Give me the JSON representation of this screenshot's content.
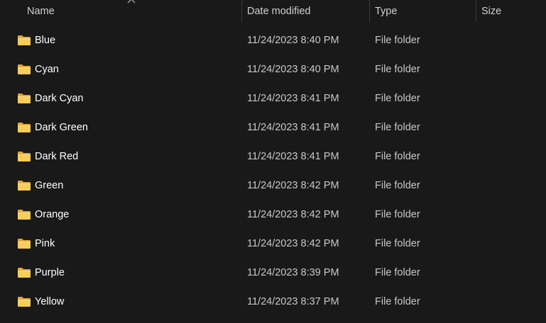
{
  "columns": {
    "name": "Name",
    "date_modified": "Date modified",
    "type": "Type",
    "size": "Size"
  },
  "icons": {
    "folder": "folder-icon",
    "sort": "sort-up-caret-icon"
  },
  "colors": {
    "background": "#191919",
    "folder_yellow": "#f4c64f"
  },
  "files": [
    {
      "name": "Blue",
      "date": "11/24/2023 8:40 PM",
      "type": "File folder",
      "size": ""
    },
    {
      "name": "Cyan",
      "date": "11/24/2023 8:40 PM",
      "type": "File folder",
      "size": ""
    },
    {
      "name": "Dark Cyan",
      "date": "11/24/2023 8:41 PM",
      "type": "File folder",
      "size": ""
    },
    {
      "name": "Dark Green",
      "date": "11/24/2023 8:41 PM",
      "type": "File folder",
      "size": ""
    },
    {
      "name": "Dark Red",
      "date": "11/24/2023 8:41 PM",
      "type": "File folder",
      "size": ""
    },
    {
      "name": "Green",
      "date": "11/24/2023 8:42 PM",
      "type": "File folder",
      "size": ""
    },
    {
      "name": "Orange",
      "date": "11/24/2023 8:42 PM",
      "type": "File folder",
      "size": ""
    },
    {
      "name": "Pink",
      "date": "11/24/2023 8:42 PM",
      "type": "File folder",
      "size": ""
    },
    {
      "name": "Purple",
      "date": "11/24/2023 8:39 PM",
      "type": "File folder",
      "size": ""
    },
    {
      "name": "Yellow",
      "date": "11/24/2023 8:37 PM",
      "type": "File folder",
      "size": ""
    }
  ]
}
